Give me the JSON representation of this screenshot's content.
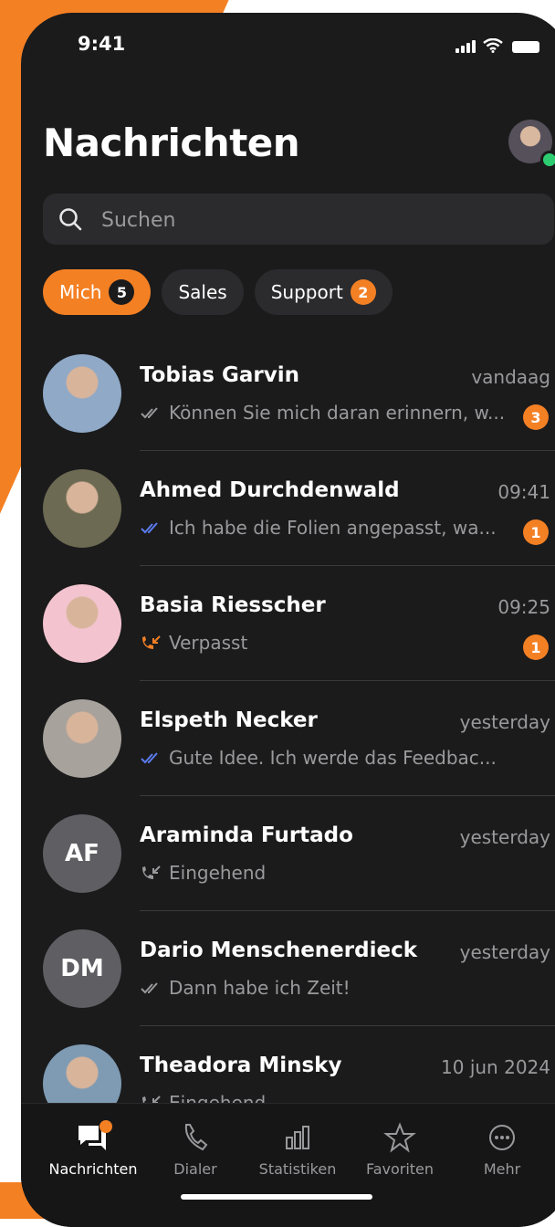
{
  "status_bar": {
    "time": "9:41"
  },
  "header": {
    "title": "Nachrichten"
  },
  "search": {
    "placeholder": "Suchen"
  },
  "filters": [
    {
      "label": "Mich",
      "badge": "5",
      "active": true
    },
    {
      "label": "Sales",
      "badge": "",
      "active": false
    },
    {
      "label": "Support",
      "badge": "2",
      "active": false
    }
  ],
  "conversations": [
    {
      "name": "Tobias Garvin",
      "time": "vandaag",
      "preview": "Können Sie mich daran erinnern, w...",
      "status": "read-grey",
      "unread": "3",
      "avatar_initials": "",
      "avatar_color": "#8fa9c7"
    },
    {
      "name": "Ahmed Durchdenwald",
      "time": "09:41",
      "preview": "Ich habe die Folien angepasst, wa...",
      "status": "read-blue",
      "unread": "1",
      "avatar_initials": "",
      "avatar_color": "#6c6a52"
    },
    {
      "name": "Basia Riesscher",
      "time": "09:25",
      "preview": "Verpasst",
      "status": "missed-call",
      "unread": "1",
      "avatar_initials": "",
      "avatar_color": "#f3c4cf"
    },
    {
      "name": "Elspeth Necker",
      "time": "yesterday",
      "preview": "Gute Idee. Ich werde das Feedbac...",
      "status": "read-blue",
      "unread": "",
      "avatar_initials": "",
      "avatar_color": "#a7a29c"
    },
    {
      "name": "Araminda Furtado",
      "time": "yesterday",
      "preview": "Eingehend",
      "status": "incoming-call",
      "unread": "",
      "avatar_initials": "AF",
      "avatar_color": "#5f5f63"
    },
    {
      "name": "Dario Menschenerdieck",
      "time": "yesterday",
      "preview": "Dann habe ich Zeit!",
      "status": "read-grey",
      "unread": "",
      "avatar_initials": "DM",
      "avatar_color": "#5f5f63"
    },
    {
      "name": "Theadora Minsky",
      "time": "10 jun 2024",
      "preview": "Eingehend",
      "status": "incoming-call",
      "unread": "",
      "avatar_initials": "",
      "avatar_color": "#7e9bb3"
    }
  ],
  "tabbar": [
    {
      "label": "Nachrichten",
      "icon": "chat-bubbles-icon",
      "active": true
    },
    {
      "label": "Dialer",
      "icon": "phone-icon",
      "active": false
    },
    {
      "label": "Statistiken",
      "icon": "bar-chart-icon",
      "active": false
    },
    {
      "label": "Favoriten",
      "icon": "star-icon",
      "active": false
    },
    {
      "label": "Mehr",
      "icon": "more-icon",
      "active": false
    }
  ],
  "colors": {
    "accent": "#F48024",
    "background": "#1b1b1c",
    "read_blue": "#5b7cf0",
    "online": "#2ecc71"
  }
}
